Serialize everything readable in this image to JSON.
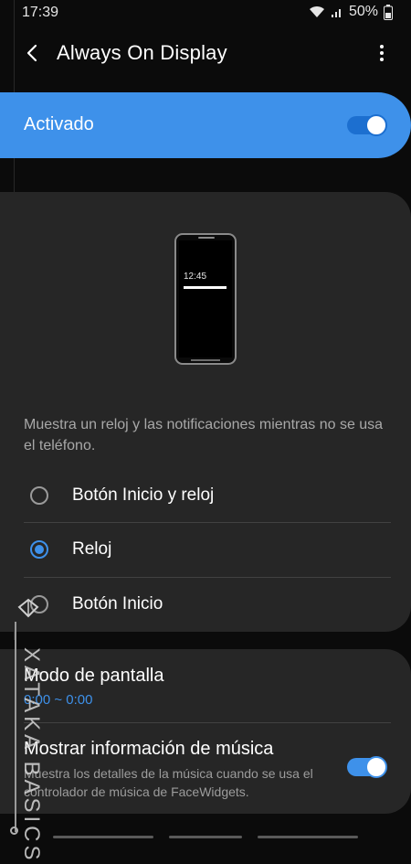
{
  "status": {
    "time": "17:39",
    "battery": "50%",
    "icons": [
      "wifi-icon",
      "signal-icon",
      "battery-icon"
    ]
  },
  "header": {
    "title": "Always On Display"
  },
  "master": {
    "label": "Activado",
    "enabled": true
  },
  "illustration": {
    "clock": "12:45"
  },
  "description": "Muestra un reloj y las notificaciones mientras no se usa el teléfono.",
  "options": [
    {
      "label": "Botón Inicio y reloj",
      "selected": false
    },
    {
      "label": "Reloj",
      "selected": true
    },
    {
      "label": "Botón Inicio",
      "selected": false
    }
  ],
  "settings": {
    "display_mode": {
      "title": "Modo de pantalla",
      "value": "0:00 ~ 0:00"
    },
    "music": {
      "title": "Mostrar información de música",
      "description": "Muestra los detalles de la música cuando se usa el controlador de música de FaceWidgets.",
      "enabled": true
    }
  },
  "watermark": {
    "text": "XATAKA BASICS"
  },
  "colors": {
    "accent": "#3e91ea",
    "card": "#262626",
    "background": "#0b0b0b"
  }
}
